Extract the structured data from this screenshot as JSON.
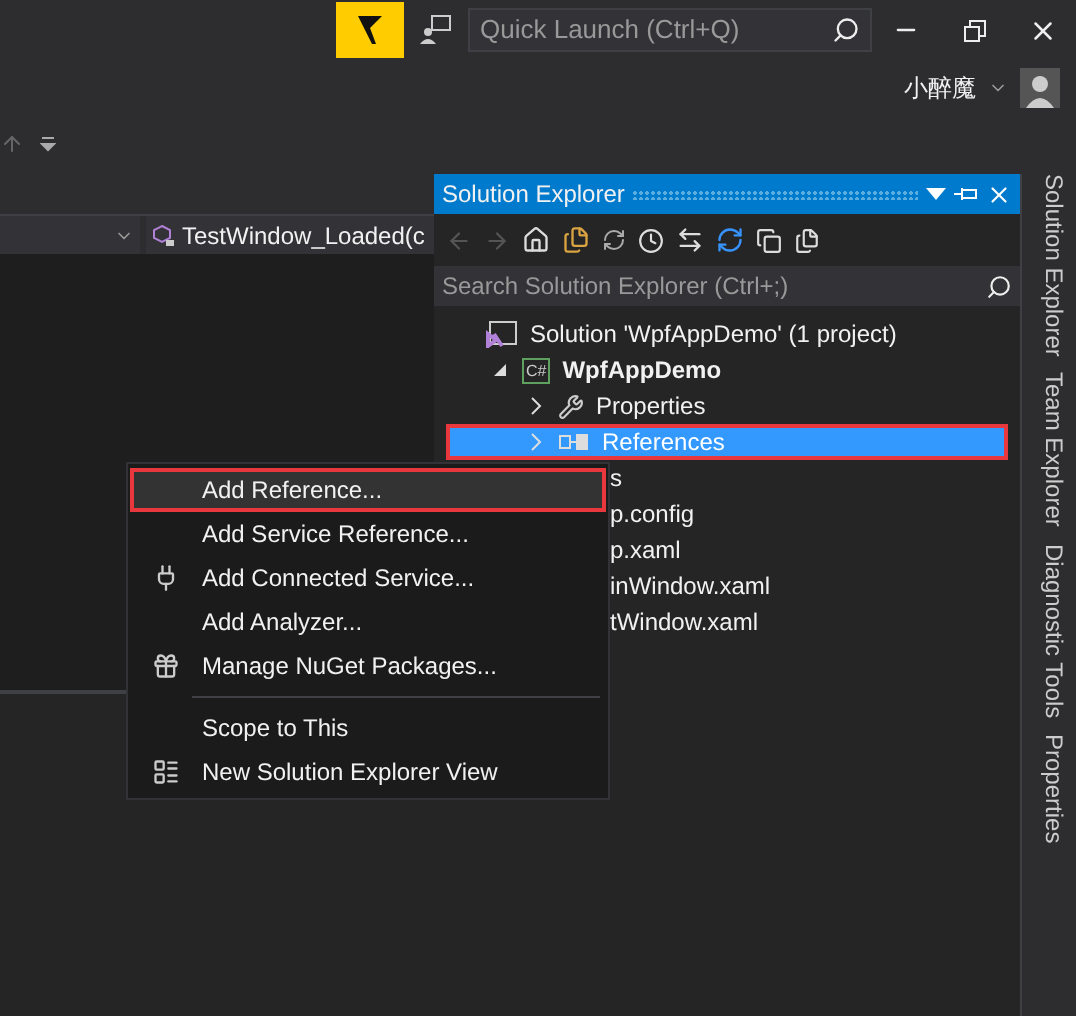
{
  "title_bar": {
    "quick_launch": {
      "placeholder": "Quick Launch (Ctrl+Q)"
    },
    "user_name": "小醉魔"
  },
  "editor": {
    "nav_bar": {
      "member_combo": "TestWindow_Loaded(c"
    }
  },
  "solution_explorer": {
    "title": "Solution Explorer",
    "search": {
      "placeholder": "Search Solution Explorer (Ctrl+;)"
    },
    "tree": [
      {
        "kind": "solution",
        "label": "Solution 'WpfAppDemo' (1 project)",
        "selected": false,
        "children": [
          {
            "kind": "project",
            "badge": "C#",
            "label": "WpfAppDemo",
            "selected": false,
            "expanded": true,
            "children": [
              {
                "kind": "properties",
                "label": "Properties",
                "selected": false,
                "expanded": false
              },
              {
                "kind": "references",
                "label": "References",
                "selected": true,
                "expanded": false
              },
              {
                "kind": "partial",
                "label": "s",
                "selected": false
              },
              {
                "kind": "partial",
                "label": "p.config",
                "selected": false
              },
              {
                "kind": "partial",
                "label": "p.xaml",
                "selected": false
              },
              {
                "kind": "partial",
                "label": "inWindow.xaml",
                "selected": false
              },
              {
                "kind": "partial",
                "label": "tWindow.xaml",
                "selected": false
              }
            ]
          }
        ]
      }
    ]
  },
  "side_tabs": [
    "Solution Explorer",
    "Team Explorer",
    "Diagnostic Tools",
    "Properties"
  ],
  "context_menu": {
    "items": [
      {
        "kind": "plain",
        "label": "Add Reference...",
        "selected": true
      },
      {
        "kind": "plain",
        "label": "Add Service Reference...",
        "selected": false
      },
      {
        "kind": "connected",
        "label": "Add Connected Service...",
        "selected": false
      },
      {
        "kind": "plain",
        "label": "Add Analyzer...",
        "selected": false
      },
      {
        "kind": "nuget",
        "label": "Manage NuGet Packages...",
        "selected": false
      },
      {
        "kind": "separator"
      },
      {
        "kind": "plain",
        "label": "Scope to This",
        "selected": false
      },
      {
        "kind": "view",
        "label": "New Solution Explorer View",
        "selected": false
      }
    ]
  }
}
